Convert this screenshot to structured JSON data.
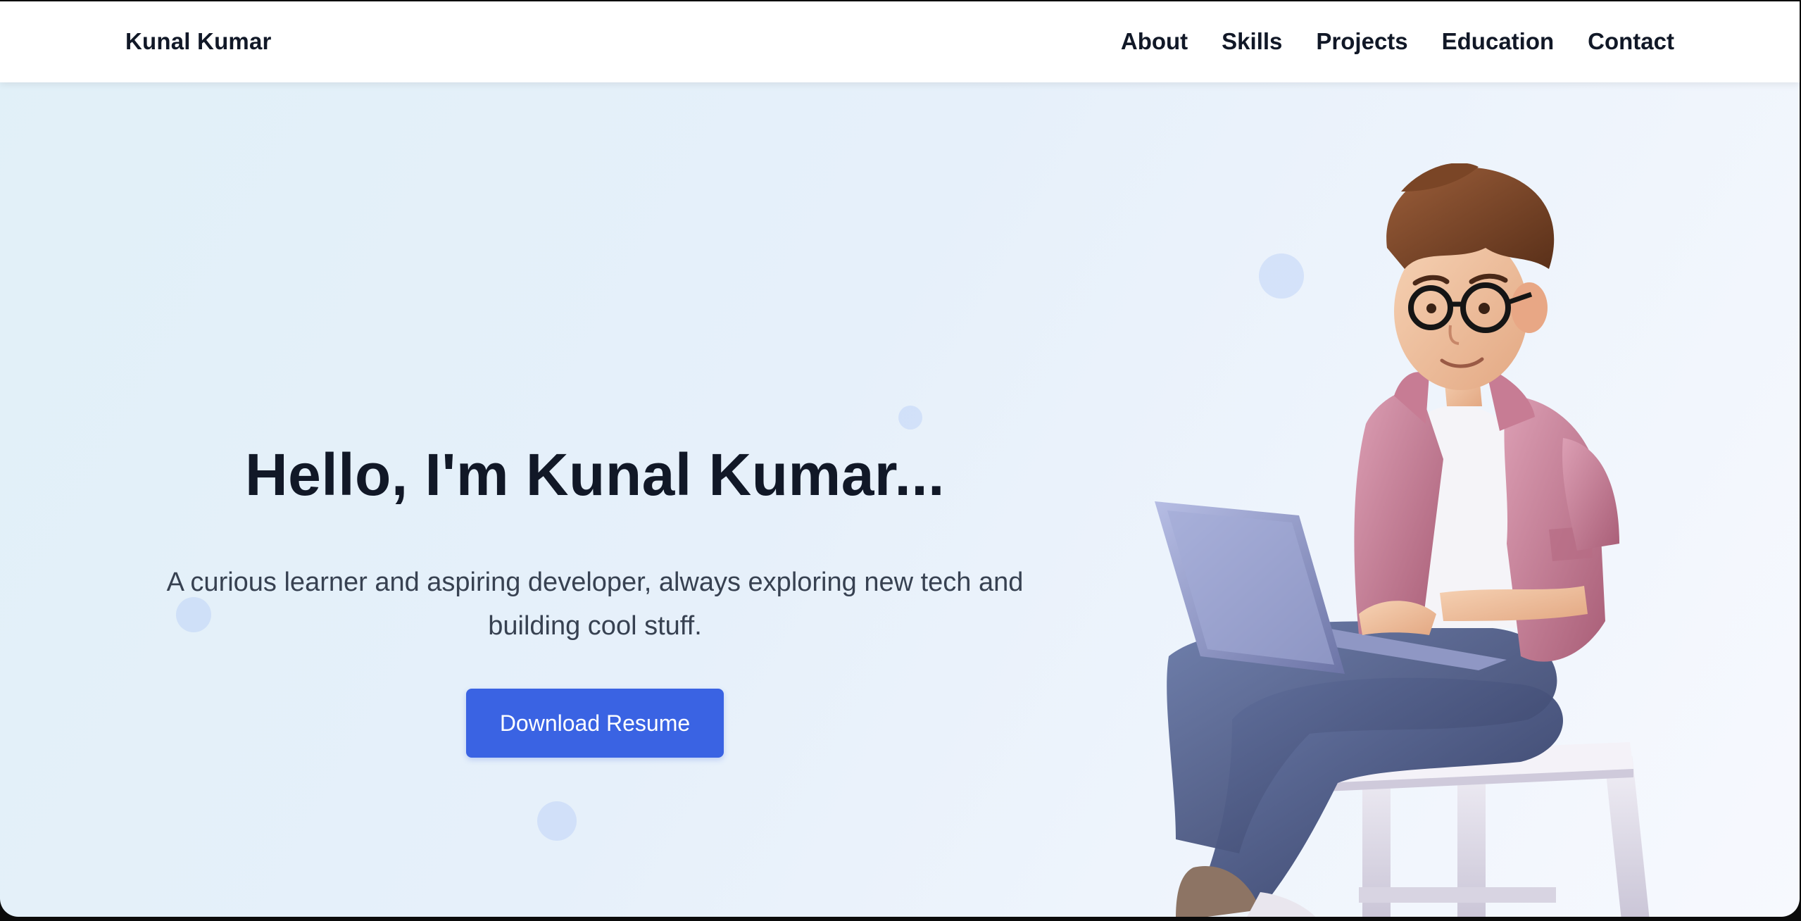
{
  "brand": {
    "name": "Kunal Kumar"
  },
  "nav": {
    "items": [
      "About",
      "Skills",
      "Projects",
      "Education",
      "Contact"
    ]
  },
  "hero": {
    "title": "Hello, I'm Kunal Kumar...",
    "subtitle": "A curious learner and aspiring developer, always exploring new tech and building cool stuff.",
    "cta_label": "Download Resume"
  },
  "illustration": {
    "icon": "developer-with-laptop-illustration"
  },
  "colors": {
    "accent": "#3a63e3",
    "text_primary": "#111827",
    "text_secondary": "#374151",
    "navbar_bg": "#ffffff"
  }
}
